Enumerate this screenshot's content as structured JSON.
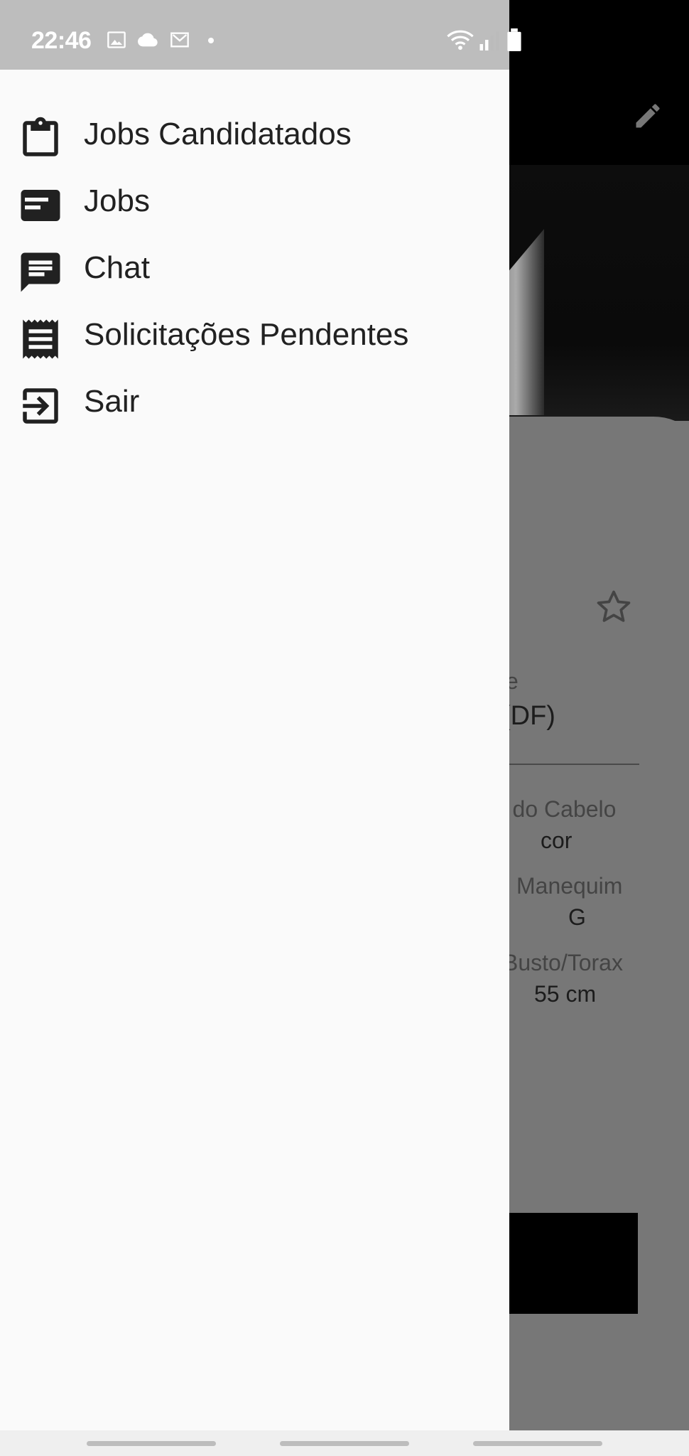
{
  "status_bar": {
    "time": "22:46",
    "left_icons": [
      "image-icon",
      "cloud-icon",
      "gmail-icon",
      "dot-icon"
    ],
    "right_icons": [
      "wifi-icon",
      "signal-icon",
      "battery-icon"
    ]
  },
  "drawer": {
    "items": [
      {
        "label": "Jobs Candidatados",
        "icon": "clipboard-icon"
      },
      {
        "label": "Jobs",
        "icon": "card-icon"
      },
      {
        "label": "Chat",
        "icon": "chat-icon"
      },
      {
        "label": "Solicitações Pendentes",
        "icon": "receipt-icon"
      },
      {
        "label": "Sair",
        "icon": "exit-icon"
      }
    ]
  },
  "background": {
    "location_partial_1": "e",
    "location_partial_2": "(DF)",
    "hair_label": "r do Cabelo",
    "hair_value": "cor",
    "size_label": "Manequim",
    "size_value": "G",
    "bust_label": "Busto/Torax",
    "bust_value": "55 cm",
    "icons": [
      "edit-icon",
      "star-icon"
    ]
  },
  "colors": {
    "drawer_bg": "#fafafa",
    "statusbar_bg": "#bdbdbd",
    "scrim": "#777777",
    "text": "#212121"
  }
}
